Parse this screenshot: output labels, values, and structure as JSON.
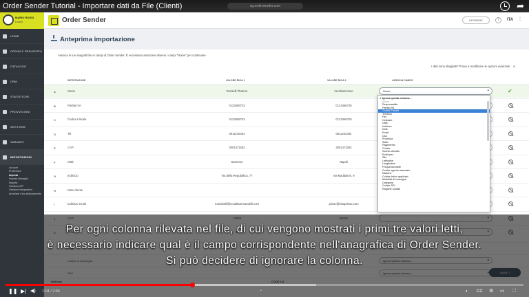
{
  "video": {
    "title": "Order Sender Tutorial - Importare dati da File (Clienti)",
    "url": "sg.ordersender.com",
    "time": "1:04 / 2:56",
    "chapter": "•",
    "progress_fraction": 0.36,
    "buffer_fraction": 0.6,
    "play_icon": "pause-icon"
  },
  "sidebar": {
    "user_name": "MARIO ROSSI",
    "user_sub": "Leader",
    "items": [
      {
        "label": "HOME",
        "icon": "home-icon"
      },
      {
        "label": "ORDINI E PREVENTIVI",
        "icon": "cart-icon"
      },
      {
        "label": "CATALOGO",
        "icon": "catalog-icon"
      },
      {
        "label": "CRM",
        "icon": "crm-icon"
      },
      {
        "label": "STATISTICHE",
        "icon": "chart-icon"
      },
      {
        "label": "PROVVIGIONI",
        "icon": "dollar-icon"
      },
      {
        "label": "GESTIONE",
        "icon": "gear-icon"
      },
      {
        "label": "VARIANTI",
        "icon": "variant-icon"
      },
      {
        "label": "IMPOSTAZIONI",
        "icon": "settings-icon"
      }
    ],
    "subitems": [
      "Account",
      "Preferenze",
      "Importa",
      "Importa Immagini",
      "Esporta",
      "Gestione API",
      "Gestione Integrazioni",
      "Annullare il tuo abbonamento"
    ]
  },
  "header": {
    "logo_text": "Order Sender",
    "upgrade_label": "UPGRADE",
    "help_label": "?",
    "lang": "ITA"
  },
  "page": {
    "title": "Anteprima importazione",
    "description": "Associa le tue anagrafiche ai campi di Order Sender. È necessario associare almeno i campi \"Nome\" per continuare",
    "hint": "I dati sono sbagliati? Prova a modificare le opzioni avanzate",
    "columns": [
      "INTESTAZIONE",
      "VALORE RIGA 1",
      "VALORE RIGA 2",
      "ASSOCIA CAMPO"
    ]
  },
  "rows": [
    {
      "key": "A",
      "name": "Nome",
      "v1": "Rosselli Pharma",
      "v2": "Verdiselezione",
      "field": "Nome",
      "ok": true
    },
    {
      "key": "B",
      "name": "Partita IVA",
      "v1": "0123456723",
      "v2": "0123456720",
      "field": "",
      "ok": false
    },
    {
      "key": "C",
      "name": "Codice Fiscale",
      "v1": "0123456723",
      "v2": "0123456720",
      "field": "",
      "ok": false
    },
    {
      "key": "D",
      "name": "Tel",
      "v1": "0511242344",
      "v2": "0511242344",
      "field": "",
      "ok": false
    },
    {
      "key": "E",
      "name": "CAP",
      "v1": "3001472262",
      "v2": "3001472262",
      "field": "",
      "ok": false
    },
    {
      "key": "F",
      "name": "Città",
      "v1": "Sanremo",
      "v2": "Napoli",
      "field": "",
      "ok": false
    },
    {
      "key": "G",
      "name": "Indirizzo",
      "v1": "Via della Repubblica, 77",
      "v2": "Via Maddaloni, 9",
      "field": "",
      "ok": false
    },
    {
      "key": "H",
      "name": "Note cliente",
      "v1": "",
      "v2": "",
      "field": "",
      "ok": false
    },
    {
      "key": "I",
      "name": "Indirizzo email",
      "v1": "mariobelli@emailtaormandelli.com",
      "v2": "prisso@visaprisso.com",
      "field": "",
      "ok": false
    },
    {
      "key": "J",
      "name": "CAP",
      "v1": "18038",
      "v2": "80134",
      "field": "",
      "ok": false
    },
    {
      "key": "K",
      "name": "Provincia",
      "v1": "IM",
      "v2": "NA",
      "field": "",
      "ok": false
    }
  ],
  "dropdown": {
    "options": [
      {
        "label": "✔ Ignora questa colonna...",
        "kind": "chk"
      },
      {
        "label": "Nome",
        "kind": "grp"
      },
      {
        "label": "Responsabile",
        "kind": ""
      },
      {
        "label": "Partita IVA",
        "kind": ""
      },
      {
        "label": "Codice Fiscale",
        "kind": "hl"
      },
      {
        "label": "Telefono",
        "kind": ""
      },
      {
        "label": "Fax",
        "kind": ""
      },
      {
        "label": "Cellulare",
        "kind": ""
      },
      {
        "label": "Città",
        "kind": ""
      },
      {
        "label": "Indirizzo",
        "kind": ""
      },
      {
        "label": "Note",
        "kind": ""
      },
      {
        "label": "Email",
        "kind": ""
      },
      {
        "label": "Cap",
        "kind": ""
      },
      {
        "label": "Provincia",
        "kind": ""
      },
      {
        "label": "Stato",
        "kind": ""
      },
      {
        "label": "Pagamento",
        "kind": ""
      },
      {
        "label": "Codice",
        "kind": ""
      },
      {
        "label": "Sconto cliccato",
        "kind": ""
      },
      {
        "label": "Email pec",
        "kind": ""
      },
      {
        "label": "Sito",
        "kind": ""
      },
      {
        "label": "Latitudine",
        "kind": ""
      },
      {
        "label": "Longitudine",
        "kind": ""
      },
      {
        "label": "Frequenza visite",
        "kind": ""
      },
      {
        "label": "Codice agente associato",
        "kind": ""
      },
      {
        "label": "Nazione",
        "kind": ""
      },
      {
        "label": "Codice listino applicato",
        "kind": ""
      },
      {
        "label": "Modalità di consegna",
        "kind": ""
      },
      {
        "label": "Categoria",
        "kind": ""
      },
      {
        "label": "Codice SDI",
        "kind": ""
      },
      {
        "label": "Ragione sociale",
        "kind": ""
      }
    ]
  },
  "lower": {
    "rows": [
      {
        "name": "Note",
        "field": "Ignora questa colonna..."
      },
      {
        "name": "Codice di Consegna",
        "field": "Ignora questa colonna..."
      },
      {
        "name": "PEC",
        "field": "Ignora questa colonna..."
      }
    ],
    "next_label": "AVANTI",
    "footer_left": "Indirizzo",
    "footer_mid": "CODE 1/4"
  },
  "subtitles": [
    "Per ogni colonna rilevata nel file, di cui vengono mostrati i primi tre valori letti,",
    "è necessario indicare qual è il campo corrispondente nell'anagrafica di Order Sender.",
    "Si può decidere di ignorare la colonna."
  ]
}
